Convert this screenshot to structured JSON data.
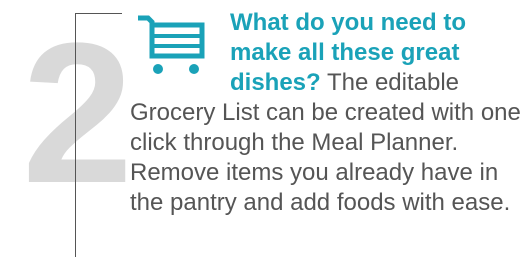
{
  "step": {
    "number": "2",
    "icon": "shopping-cart-icon",
    "highlight_text": "What do you need to make all these great dishes?",
    "body_text": " The editable Grocery List can be created with one click through the Meal Planner. Remove items you already have in the pantry and add foods with ease."
  },
  "colors": {
    "accent": "#1aa2b8",
    "number": "#d9d9d9",
    "text": "#555555",
    "bracket": "#555555"
  }
}
